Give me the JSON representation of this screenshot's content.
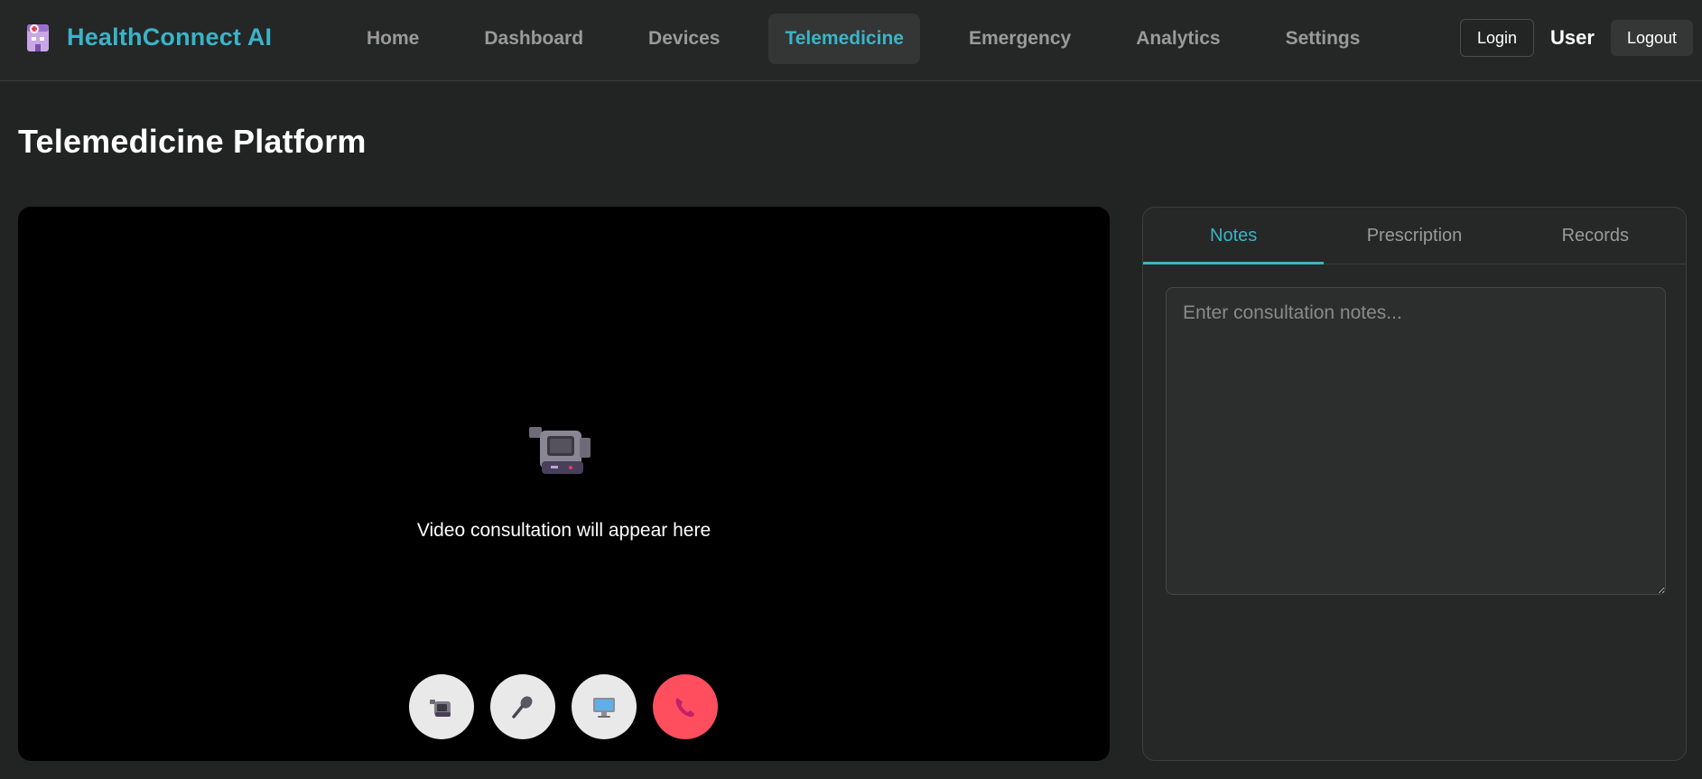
{
  "brand": {
    "name": "HealthConnect AI",
    "icon": "hospital-icon"
  },
  "nav": {
    "items": [
      {
        "label": "Home",
        "active": false
      },
      {
        "label": "Dashboard",
        "active": false
      },
      {
        "label": "Devices",
        "active": false
      },
      {
        "label": "Telemedicine",
        "active": true
      },
      {
        "label": "Emergency",
        "active": false
      },
      {
        "label": "Analytics",
        "active": false
      },
      {
        "label": "Settings",
        "active": false
      }
    ]
  },
  "auth": {
    "login_label": "Login",
    "user_label": "User",
    "logout_label": "Logout"
  },
  "page": {
    "title": "Telemedicine Platform"
  },
  "video": {
    "icon": "video-camera-icon",
    "placeholder": "Video consultation will appear here",
    "controls": [
      {
        "name": "camera",
        "icon": "video-camera-icon"
      },
      {
        "name": "microphone",
        "icon": "microphone-icon"
      },
      {
        "name": "screen-share",
        "icon": "desktop-icon"
      },
      {
        "name": "end-call",
        "icon": "phone-icon"
      }
    ]
  },
  "side_panel": {
    "tabs": [
      {
        "label": "Notes",
        "active": true
      },
      {
        "label": "Prescription",
        "active": false
      },
      {
        "label": "Records",
        "active": false
      }
    ],
    "notes": {
      "placeholder": "Enter consultation notes...",
      "value": ""
    }
  },
  "colors": {
    "accent": "#3ab4c8",
    "background": "#222323",
    "end_call": "#ff4f5e"
  }
}
